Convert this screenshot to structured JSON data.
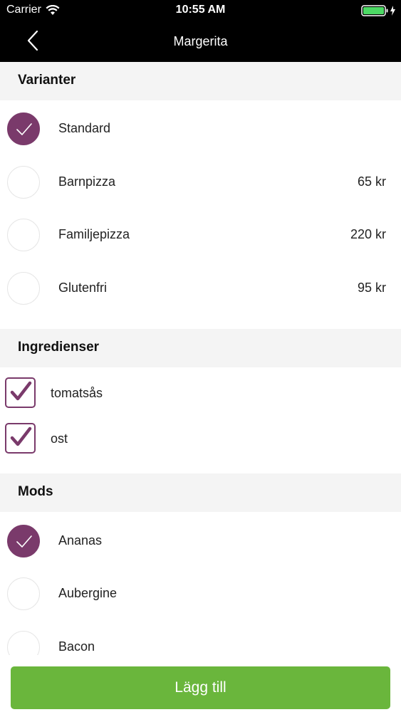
{
  "status_bar": {
    "carrier": "Carrier",
    "time": "10:55 AM",
    "battery_color": "#4cd964"
  },
  "nav": {
    "title": "Margerita",
    "back_icon": "chevron-left-icon"
  },
  "colors": {
    "accent": "#7a3a6b",
    "primary_button": "#6ab63c",
    "section_bg": "#f4f4f4"
  },
  "variants": {
    "header": "Varianter",
    "items": [
      {
        "label": "Standard",
        "price": "",
        "selected": true
      },
      {
        "label": "Barnpizza",
        "price": "65 kr",
        "selected": false
      },
      {
        "label": "Familjepizza",
        "price": "220 kr",
        "selected": false
      },
      {
        "label": "Glutenfri",
        "price": "95 kr",
        "selected": false
      }
    ]
  },
  "ingredients": {
    "header": "Ingredienser",
    "items": [
      {
        "label": "tomatsås",
        "checked": true
      },
      {
        "label": "ost",
        "checked": true
      }
    ]
  },
  "mods": {
    "header": "Mods",
    "items": [
      {
        "label": "Ananas",
        "selected": true
      },
      {
        "label": "Aubergine",
        "selected": false
      },
      {
        "label": "Bacon",
        "selected": false
      }
    ]
  },
  "footer": {
    "add_label": "Lägg till"
  }
}
